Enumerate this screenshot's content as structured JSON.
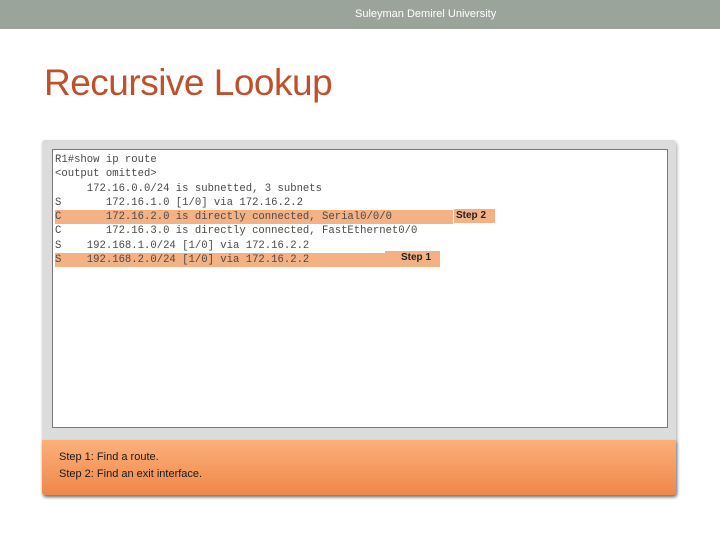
{
  "header": {
    "university": "Suleyman Demirel University"
  },
  "slide": {
    "title": "Recursive Lookup"
  },
  "terminal": {
    "lines": [
      "R1#show ip route",
      "<output omitted>",
      "     172.16.0.0/24 is subnetted, 3 subnets",
      "S       172.16.1.0 [1/0] via 172.16.2.2",
      "C       172.16.2.0 is directly connected, Serial0/0/0",
      "C       172.16.3.0 is directly connected, FastEthernet0/0",
      "S    192.168.1.0/24 [1/0] via 172.16.2.2",
      "S    192.168.2.0/24 [1/0] via 172.16.2.2"
    ]
  },
  "steps": {
    "step2_label": "Step 2",
    "step1_label": "Step 1"
  },
  "notes": {
    "step1": "Step 1: Find a route.",
    "step2": "Step 2: Find an exit interface."
  },
  "colors": {
    "accent": "#c0502a",
    "highlight": "#f4b184",
    "topbar": "#9aa49a",
    "notes_bg": "#f59a5c"
  }
}
